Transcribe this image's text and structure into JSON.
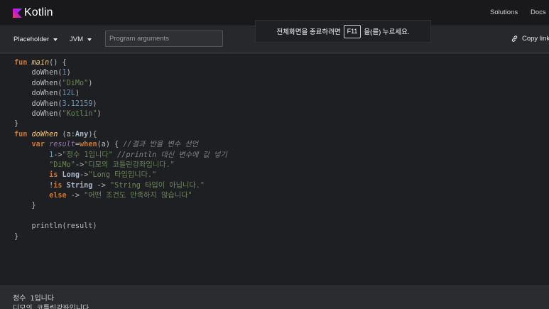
{
  "header": {
    "logo_text": "Kotlin",
    "nav": [
      "Solutions",
      "Docs"
    ]
  },
  "toolbar": {
    "version_label": "Placeholder",
    "target_label": "JVM",
    "args_placeholder": "Program arguments",
    "copy_label": "Copy link"
  },
  "fullscreen_notice": {
    "before": "전체화면을 종료하려면",
    "key": "F11",
    "after": "을(를) 누르세요."
  },
  "code": [
    [
      {
        "t": "fun ",
        "c": "kw"
      },
      {
        "t": "main",
        "c": "fn"
      },
      {
        "t": "() {"
      }
    ],
    [
      {
        "t": "    doWhen("
      },
      {
        "t": "1",
        "c": "num"
      },
      {
        "t": ")"
      }
    ],
    [
      {
        "t": "    doWhen("
      },
      {
        "t": "\"DiMo\"",
        "c": "str"
      },
      {
        "t": ")"
      }
    ],
    [
      {
        "t": "    doWhen("
      },
      {
        "t": "12L",
        "c": "num"
      },
      {
        "t": ")"
      }
    ],
    [
      {
        "t": "    doWhen("
      },
      {
        "t": "3.12159",
        "c": "num"
      },
      {
        "t": ")"
      }
    ],
    [
      {
        "t": "    doWhen("
      },
      {
        "t": "\"Kotlin\"",
        "c": "str"
      },
      {
        "t": ")"
      }
    ],
    [
      {
        "t": "}"
      }
    ],
    [
      {
        "t": "fun ",
        "c": "kw"
      },
      {
        "t": "doWhen",
        "c": "fn"
      },
      {
        "t": " (a:"
      },
      {
        "t": "Any",
        "c": "ty"
      },
      {
        "t": "){"
      }
    ],
    [
      {
        "t": "    "
      },
      {
        "t": "var ",
        "c": "kw"
      },
      {
        "t": "result",
        "c": "var"
      },
      {
        "t": "="
      },
      {
        "t": "when",
        "c": "kw"
      },
      {
        "t": "(a) { "
      },
      {
        "t": "//결과 반을 변수 선언",
        "c": "cmt"
      }
    ],
    [
      {
        "t": "        "
      },
      {
        "t": "1",
        "c": "num"
      },
      {
        "t": "->"
      },
      {
        "t": "\"정수 1입니다\"",
        "c": "str"
      },
      {
        "t": " "
      },
      {
        "t": "//println 대신 변수에 값 넣기",
        "c": "cmt"
      }
    ],
    [
      {
        "t": "        "
      },
      {
        "t": "\"DiMo\"",
        "c": "str"
      },
      {
        "t": "->"
      },
      {
        "t": "\"디모의 코틀린강좌입니다.\"",
        "c": "str"
      }
    ],
    [
      {
        "t": "        "
      },
      {
        "t": "is ",
        "c": "kw"
      },
      {
        "t": "Long",
        "c": "ty"
      },
      {
        "t": "->"
      },
      {
        "t": "\"Long 타입입니다.\"",
        "c": "str"
      }
    ],
    [
      {
        "t": "        !"
      },
      {
        "t": "is ",
        "c": "kw"
      },
      {
        "t": "String",
        "c": "ty"
      },
      {
        "t": " -> "
      },
      {
        "t": "\"String 타입이 아닙니다.\"",
        "c": "str"
      }
    ],
    [
      {
        "t": "        "
      },
      {
        "t": "else ",
        "c": "kw"
      },
      {
        "t": "-> "
      },
      {
        "t": "\"어떤 조건도 만족하지 않습니다\"",
        "c": "str"
      }
    ],
    [
      {
        "t": "    }"
      }
    ],
    [
      {
        "t": ""
      }
    ],
    [
      {
        "t": "    println(result)"
      }
    ],
    [
      {
        "t": "}"
      }
    ]
  ],
  "output": {
    "line1": "정수 1입니다",
    "line2": "디모의 코틀린강좌입니다."
  },
  "colors": {
    "keyword": "#cc7832",
    "string": "#6a8759",
    "number": "#6897bb",
    "comment": "#808080",
    "function": "#ffc66d",
    "logo_gradient": [
      "#7f52ff",
      "#e44857"
    ]
  }
}
